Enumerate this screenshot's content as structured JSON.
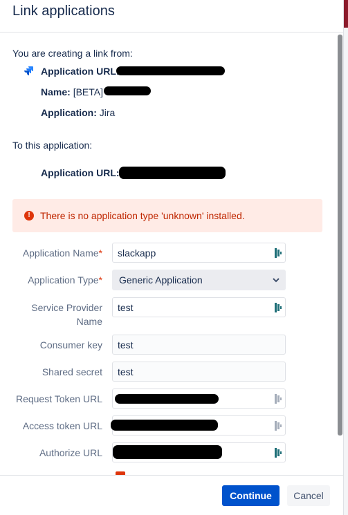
{
  "dialog": {
    "title": "Link applications",
    "from_intro": "You are creating a link from:",
    "from": {
      "app_url_label": "Application URL:",
      "name_label": "Name:",
      "name_value": "[BETA]",
      "application_label": "Application:",
      "application_value": "Jira"
    },
    "to_intro": "To this application:",
    "to": {
      "app_url_label": "Application URL:"
    },
    "error": {
      "icon": "error-icon",
      "message": "There is no application type 'unknown' installed."
    },
    "form": {
      "application_name_label": "Application Name",
      "application_name_value": "slackapp",
      "application_type_label": "Application Type",
      "application_type_value": "Generic Application",
      "service_provider_label_1": "Service Provider",
      "service_provider_label_2": "Name",
      "service_provider_value": "test",
      "consumer_key_label": "Consumer key",
      "consumer_key_value": "test",
      "shared_secret_label": "Shared secret",
      "shared_secret_value": "test",
      "request_token_label": "Request Token URL",
      "access_token_label": "Access token URL",
      "authorize_label": "Authorize URL",
      "required_marker": "*"
    },
    "footer": {
      "continue_label": "Continue",
      "cancel_label": "Cancel"
    }
  },
  "colors": {
    "primary": "#0052cc",
    "error_bg": "#ffebe6",
    "error_text": "#bf2600",
    "required": "#de350b"
  }
}
